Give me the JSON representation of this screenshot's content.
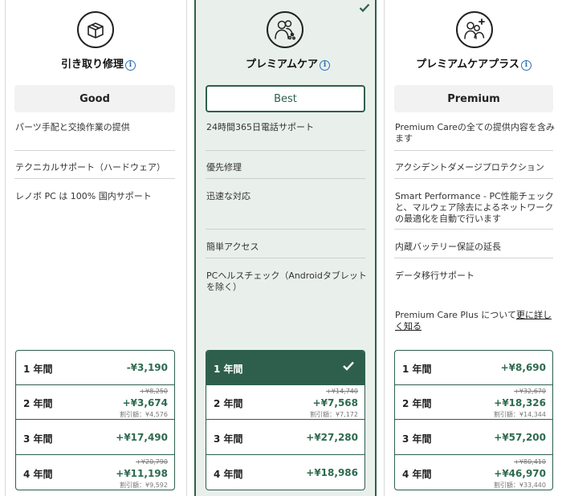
{
  "plans": [
    {
      "title": "引き取り修理",
      "icon": "repair-box-icon",
      "tier": "Good",
      "features": [
        "パーツ手配と交換作業の提供",
        "テクニカルサポート（ハードウェア）",
        "レノボ PC は 100% 国内サポート"
      ],
      "prices": [
        {
          "label": "1 年間",
          "price": "-¥3,190"
        },
        {
          "label": "2 年間",
          "strike": "+¥8,250",
          "price": "+¥3,674",
          "discount": "割引額：¥4,576"
        },
        {
          "label": "3 年間",
          "price": "+¥17,490"
        },
        {
          "label": "4 年間",
          "strike": "+¥20,790",
          "price": "+¥11,198",
          "discount": "割引額：¥9,592"
        }
      ]
    },
    {
      "title": "プレミアムケア",
      "icon": "people-group-icon",
      "tier": "Best",
      "features": [
        "24時間365日電話サポート",
        "優先修理",
        "迅速な対応",
        "簡単アクセス",
        "PCヘルスチェック（Androidタブレットを除く）"
      ],
      "prices": [
        {
          "label": "1 年間",
          "price": ""
        },
        {
          "label": "2 年間",
          "strike": "+¥14,740",
          "price": "+¥7,568",
          "discount": "割引額：¥7,172"
        },
        {
          "label": "3 年間",
          "price": "+¥27,280"
        },
        {
          "label": "4 年間",
          "price": "+¥18,986"
        }
      ]
    },
    {
      "title": "プレミアムケアプラス",
      "icon": "people-plus-icon",
      "tier": "Premium",
      "features": [
        "Premium Careの全ての提供内容を含みます",
        "アクシデントダメージプロテクション",
        "Smart Performance - PC性能チェックと、マルウェア除去によるネットワークの最適化を自動で行います",
        "内蔵バッテリー保証の延長",
        "データ移行サポート"
      ],
      "more_text": "Premium Care Plus について",
      "more_link": "更に詳しく知る",
      "prices": [
        {
          "label": "1 年間",
          "price": "+¥8,690"
        },
        {
          "label": "2 年間",
          "strike": "+¥32,670",
          "price": "+¥18,326",
          "discount": "割引額：¥14,344"
        },
        {
          "label": "3 年間",
          "price": "+¥57,200"
        },
        {
          "label": "4 年間",
          "strike": "+¥80,410",
          "price": "+¥46,970",
          "discount": "割引額：¥33,440"
        }
      ]
    }
  ],
  "colors": {
    "accent": "#2e5f4d",
    "price": "#2e6a4f",
    "selected_bg": "#e9f0ec"
  }
}
